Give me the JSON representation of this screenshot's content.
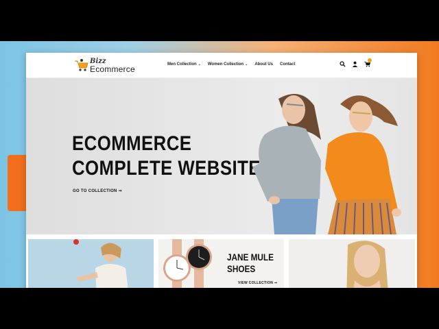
{
  "brand": {
    "line1": "Bizz",
    "line2": "Ecommerce",
    "accent": "#f4a21d"
  },
  "nav": {
    "items": [
      {
        "label": "Men Collection",
        "has_dropdown": true
      },
      {
        "label": "Women Collection",
        "has_dropdown": true
      },
      {
        "label": "About Us",
        "has_dropdown": false
      },
      {
        "label": "Contact",
        "has_dropdown": false
      }
    ],
    "icons": [
      "search-icon",
      "user-icon",
      "cart-icon"
    ],
    "dropdown_glyph": "⌄"
  },
  "hero": {
    "title_line1": "ECOMMERCE",
    "title_line2": "COMPLETE WEBSITE",
    "cta": "GO TO COLLECTION ➞"
  },
  "cards": {
    "card2": {
      "title_line1": "JANE MULE",
      "title_line2": "SHOES",
      "cta": "VIEW COLLECTION ➞"
    }
  },
  "colors": {
    "background_left": "#7cc4e4",
    "background_right": "#f27a20",
    "orange_tab": "#f36f1e",
    "sweater_orange": "#f28a1c",
    "sweater_grey": "#a9b2b6"
  }
}
